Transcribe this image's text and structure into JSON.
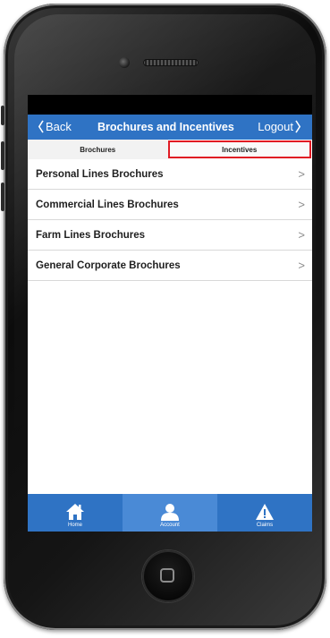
{
  "nav": {
    "back_label": "Back",
    "title": "Brochures and Incentives",
    "logout_label": "Logout"
  },
  "segments": {
    "brochures_label": "Brochures",
    "incentives_label": "Incentives"
  },
  "list": {
    "items": [
      {
        "label": "Personal Lines Brochures"
      },
      {
        "label": "Commercial Lines Brochures"
      },
      {
        "label": "Farm Lines Brochures"
      },
      {
        "label": "General Corporate Brochures"
      }
    ],
    "chevron": ">"
  },
  "tabbar": {
    "home_label": "Home",
    "account_label": "Account",
    "claims_label": "Claims"
  },
  "colors": {
    "brand": "#2f73c4",
    "highlight": "#e01b24"
  }
}
